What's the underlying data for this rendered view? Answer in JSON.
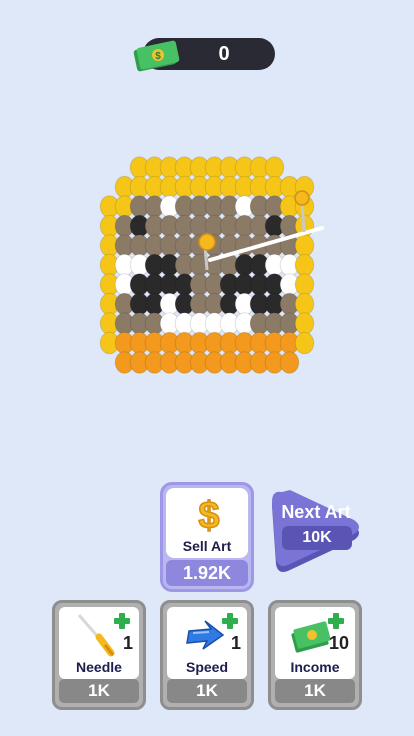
{
  "hud": {
    "money": "0",
    "money_icon": "cash-stack-icon"
  },
  "sell": {
    "title": "Sell Art",
    "price": "1.92K",
    "icon": "dollar-sign-icon"
  },
  "next_art": {
    "title": "Next Art",
    "price": "10K"
  },
  "upgrades": [
    {
      "title": "Needle",
      "level": "1",
      "price": "1K",
      "icon": "needle-icon"
    },
    {
      "title": "Speed",
      "level": "1",
      "price": "1K",
      "icon": "speed-arrow-icon"
    },
    {
      "title": "Income",
      "level": "10",
      "price": "1K",
      "icon": "cash-stack-icon"
    }
  ],
  "colors": {
    "background": "#dfe8f8",
    "yellow": "#f5c518",
    "orange": "#f39a1e",
    "brown": "#8a7a66",
    "black": "#2a2a2a",
    "white": "#ffffff",
    "accent": "#8d87dd",
    "button_gray": "#888888"
  }
}
